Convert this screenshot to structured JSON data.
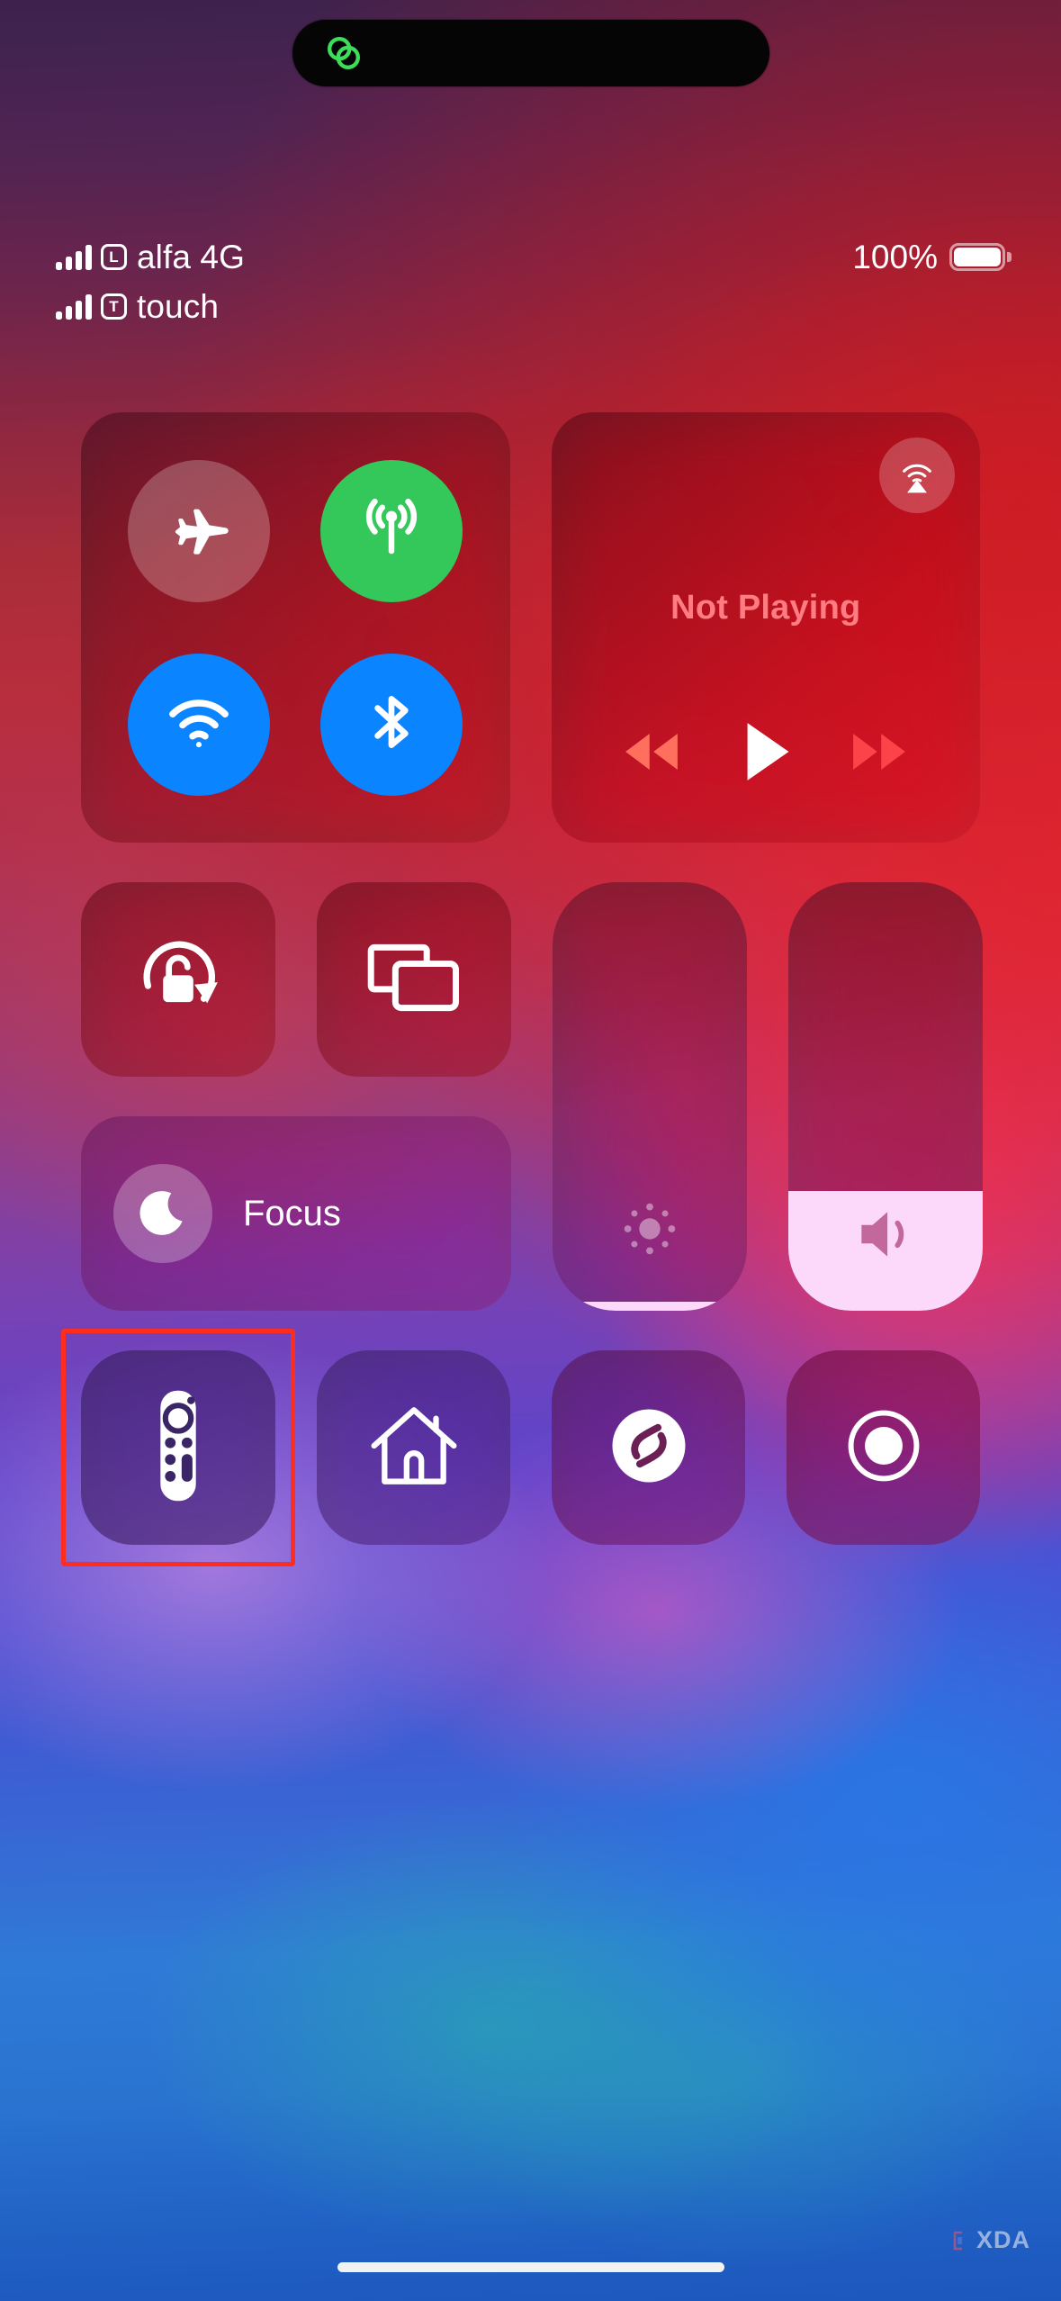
{
  "dynamic_island": {
    "icon": "linked-rings-icon",
    "icon_color": "#3ddc5a"
  },
  "status_bar": {
    "lines": [
      {
        "signal_icon": "signal-bars-icon",
        "sim_badge": "L",
        "carrier": "alfa 4G"
      },
      {
        "signal_icon": "signal-bars-icon",
        "sim_badge": "T",
        "carrier": "touch"
      }
    ],
    "battery_percent": "100%",
    "battery_level": 100,
    "battery_icon": "battery-full-icon"
  },
  "control_center": {
    "connectivity": {
      "toggles": [
        {
          "name": "airplane-mode",
          "icon": "airplane-icon",
          "state": "off",
          "color": "rgba(255,255,255,0.24)"
        },
        {
          "name": "cellular-data",
          "icon": "cellular-antenna-icon",
          "state": "on",
          "color": "#34c759"
        },
        {
          "name": "wifi",
          "icon": "wifi-icon",
          "state": "on",
          "color": "#0a84ff"
        },
        {
          "name": "bluetooth",
          "icon": "bluetooth-icon",
          "state": "on",
          "color": "#0a84ff"
        }
      ]
    },
    "media": {
      "airplay_icon": "airplay-audio-icon",
      "now_playing": "Not Playing",
      "now_playing_color": "#ff7d82",
      "controls": [
        {
          "name": "rewind-button",
          "icon": "rewind-icon",
          "color": "#ff6f5e"
        },
        {
          "name": "play-button",
          "icon": "play-icon",
          "color": "#ffffff"
        },
        {
          "name": "fast-forward-button",
          "icon": "fast-forward-icon",
          "color": "#fc4349"
        }
      ]
    },
    "small_tiles": [
      {
        "name": "rotation-lock",
        "icon": "rotation-lock-icon",
        "state": "unlocked"
      },
      {
        "name": "screen-mirroring",
        "icon": "screen-mirroring-icon",
        "state": "off"
      }
    ],
    "focus": {
      "icon": "crescent-moon-icon",
      "label": "Focus"
    },
    "sliders": [
      {
        "name": "brightness-slider",
        "icon": "brightness-icon",
        "value": 2,
        "unit": "%"
      },
      {
        "name": "volume-slider",
        "icon": "speaker-wave-icon",
        "value": 28,
        "unit": "%"
      }
    ],
    "app_tiles": [
      {
        "name": "apple-tv-remote",
        "icon": "tv-remote-icon",
        "highlighted": true
      },
      {
        "name": "home",
        "icon": "home-house-icon",
        "highlighted": false
      },
      {
        "name": "music-recognition",
        "icon": "shazam-icon",
        "highlighted": false
      },
      {
        "name": "screen-recording",
        "icon": "record-circle-icon",
        "highlighted": false
      }
    ],
    "highlight_color": "#ff2d20"
  },
  "home_indicator": {
    "name": "home-indicator"
  },
  "watermark": {
    "text": "XDA"
  }
}
